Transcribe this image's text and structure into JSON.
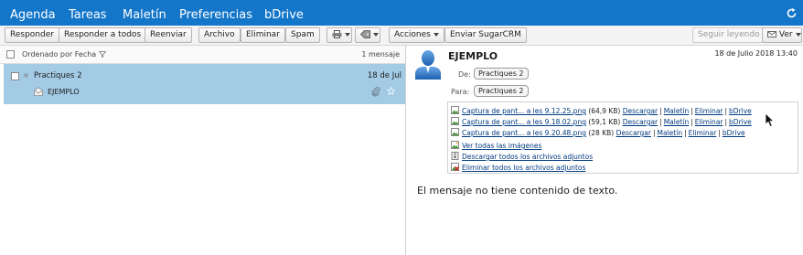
{
  "nav": {
    "tabs": [
      "Agenda",
      "Tareas",
      "Maletín",
      "Preferencias",
      "bDrive"
    ]
  },
  "toolbar": {
    "responder": "Responder",
    "responder_todos": "Responder a todos",
    "reenviar": "Reenviar",
    "archivo": "Archivo",
    "eliminar": "Eliminar",
    "spam": "Spam",
    "acciones": "Acciones",
    "enviar_sugarcrm": "Enviar SugarCRM",
    "seguir_leyendo": "Seguir leyendo",
    "ver": "Ver"
  },
  "list": {
    "sort_label": "Ordenado por Fecha",
    "count": "1 mensaje",
    "messages": [
      {
        "sender": "Practiques 2",
        "date": "18 de Jul",
        "subject": "EJEMPLO"
      }
    ]
  },
  "message": {
    "subject": "EJEMPLO",
    "date": "18 de Julio 2018 13:40",
    "from_label": "De:",
    "from": "Practiques 2",
    "to_label": "Para:",
    "to": "Practiques 2",
    "attachments": [
      {
        "name": "Captura de pant... a les 9.12.25.png",
        "size": "(64,9 KB)"
      },
      {
        "name": "Captura de pant... a les 9.18.02.png",
        "size": "(59,1 KB)"
      },
      {
        "name": "Captura de pant... a les 9.20.48.png",
        "size": "(28 KB)"
      }
    ],
    "attachment_links": {
      "descargar": "Descargar",
      "maletin": "Maletín",
      "eliminar": "Eliminar",
      "bdrive": "bDrive"
    },
    "actions": {
      "ver_imagenes": "Ver todas las imágenes",
      "descargar_todos": "Descargar todos los archivos adjuntos",
      "eliminar_todos": "Eliminar todos los archivos adjuntos"
    },
    "body": "El mensaje no tiene contenido de texto."
  },
  "colors": {
    "nav_bg": "#1376c9",
    "selected_row": "#a3cbe6",
    "link": "#003a80"
  }
}
